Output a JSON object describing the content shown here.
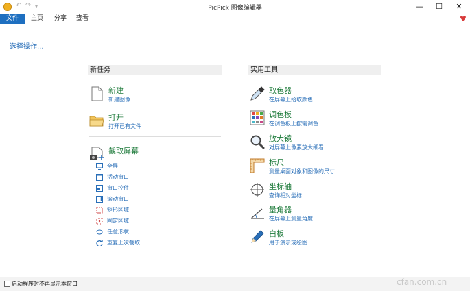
{
  "window": {
    "title": "PicPick 图像编辑器",
    "minimize": "—",
    "maximize": "☐",
    "close": "✕"
  },
  "quick_access": {
    "undo": "↶",
    "redo": "↷",
    "more": "▾"
  },
  "menu": [
    "文件",
    "主页",
    "分享",
    "查看"
  ],
  "prompt": "选择操作...",
  "new_task": {
    "header": "新任务",
    "items": [
      {
        "title": "新建",
        "desc": "新建图像"
      },
      {
        "title": "打开",
        "desc": "打开已有文件"
      }
    ],
    "capture": {
      "title": "截取屏幕",
      "options": [
        "全屏",
        "活动窗口",
        "窗口控件",
        "滚动窗口",
        "矩形区域",
        "固定区域",
        "任意形状",
        "重复上次截取"
      ]
    }
  },
  "tools": {
    "header": "实用工具",
    "items": [
      {
        "title": "取色器",
        "desc": "在屏幕上拾取颜色"
      },
      {
        "title": "调色板",
        "desc": "在调色板上按需调色"
      },
      {
        "title": "放大镜",
        "desc": "对屏幕上像素放大细看"
      },
      {
        "title": "标尺",
        "desc": "测量桌面对象和图像的尺寸"
      },
      {
        "title": "坐标轴",
        "desc": "查询相对坐标"
      },
      {
        "title": "量角器",
        "desc": "在屏幕上测量角度"
      },
      {
        "title": "白板",
        "desc": "用于演示或绘图"
      }
    ]
  },
  "status": {
    "checkbox_label": "启动程序时不再显示本窗口",
    "checked": false
  },
  "watermark": "cfan.com.cn",
  "colors": {
    "accent": "#1e6fc0",
    "link": "#2a6fb8",
    "title_green": "#1d7a3a",
    "heart": "#d83b3b"
  }
}
